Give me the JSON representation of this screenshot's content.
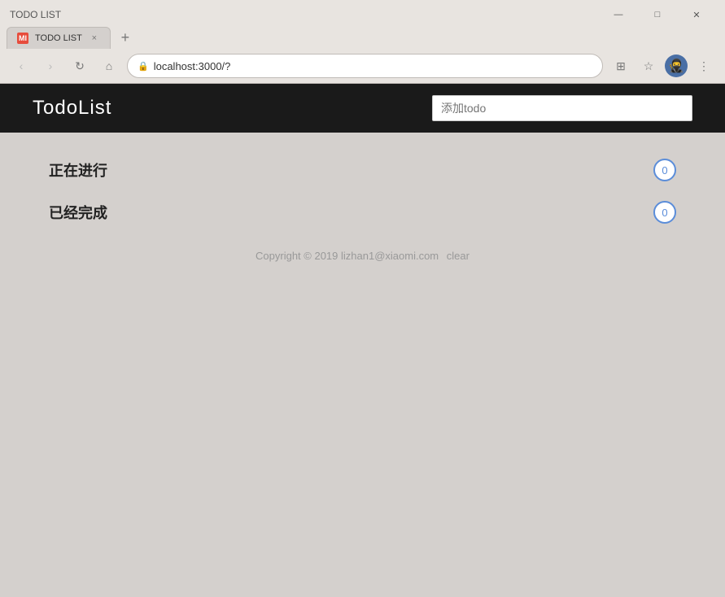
{
  "browser": {
    "title_bar": {
      "title": "TODO LIST"
    },
    "tab": {
      "favicon_text": "MI",
      "title": "TODO LIST",
      "close_label": "×"
    },
    "new_tab_label": "+",
    "address": "localhost:3000/?",
    "nav": {
      "back_label": "‹",
      "forward_label": "›",
      "refresh_label": "↻",
      "home_label": "⌂"
    },
    "window_controls": {
      "minimize": "—",
      "maximize": "□",
      "close": "✕"
    }
  },
  "app": {
    "title": "TodoList",
    "input_placeholder": "添加todo",
    "sections": [
      {
        "label": "正在进行",
        "count": "0"
      },
      {
        "label": "已经完成",
        "count": "0"
      }
    ],
    "footer": {
      "copyright": "Copyright © 2019 lizhan1@xiaomi.com",
      "clear_label": "clear"
    }
  }
}
